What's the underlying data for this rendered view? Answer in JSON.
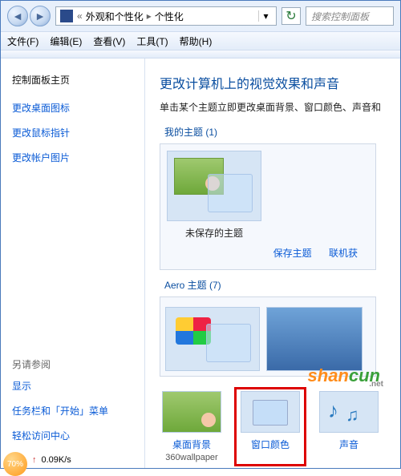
{
  "breadcrumb": {
    "item1": "外观和个性化",
    "item2": "个性化"
  },
  "search": {
    "placeholder": "搜索控制面板"
  },
  "menu": {
    "file": "文件(F)",
    "edit": "编辑(E)",
    "view": "查看(V)",
    "tools": "工具(T)",
    "help": "帮助(H)"
  },
  "sidebar": {
    "home": "控制面板主页",
    "links": [
      "更改桌面图标",
      "更改鼠标指针",
      "更改帐户图片"
    ],
    "see_also_hdr": "另请参阅",
    "see_also": [
      "显示",
      "任务栏和「开始」菜单",
      "轻松访问中心"
    ]
  },
  "main": {
    "title": "更改计算机上的视觉效果和声音",
    "desc": "单击某个主题立即更改桌面背景、窗口颜色、声音和",
    "my_themes_hdr": "我的主题 (1)",
    "unsaved_label": "未保存的主题",
    "save_theme": "保存主题",
    "get_online": "联机获",
    "aero_hdr": "Aero 主题 (7)",
    "bottom": {
      "bg": {
        "label": "桌面背景",
        "sub": "360wallpaper"
      },
      "color": {
        "label": "窗口颜色"
      },
      "sound": {
        "label": "声音"
      }
    }
  },
  "watermark": {
    "part1": "shan",
    "part2": "cun",
    "net": ".net"
  },
  "status": {
    "pct": "70%",
    "speed": "0.09K/s"
  }
}
